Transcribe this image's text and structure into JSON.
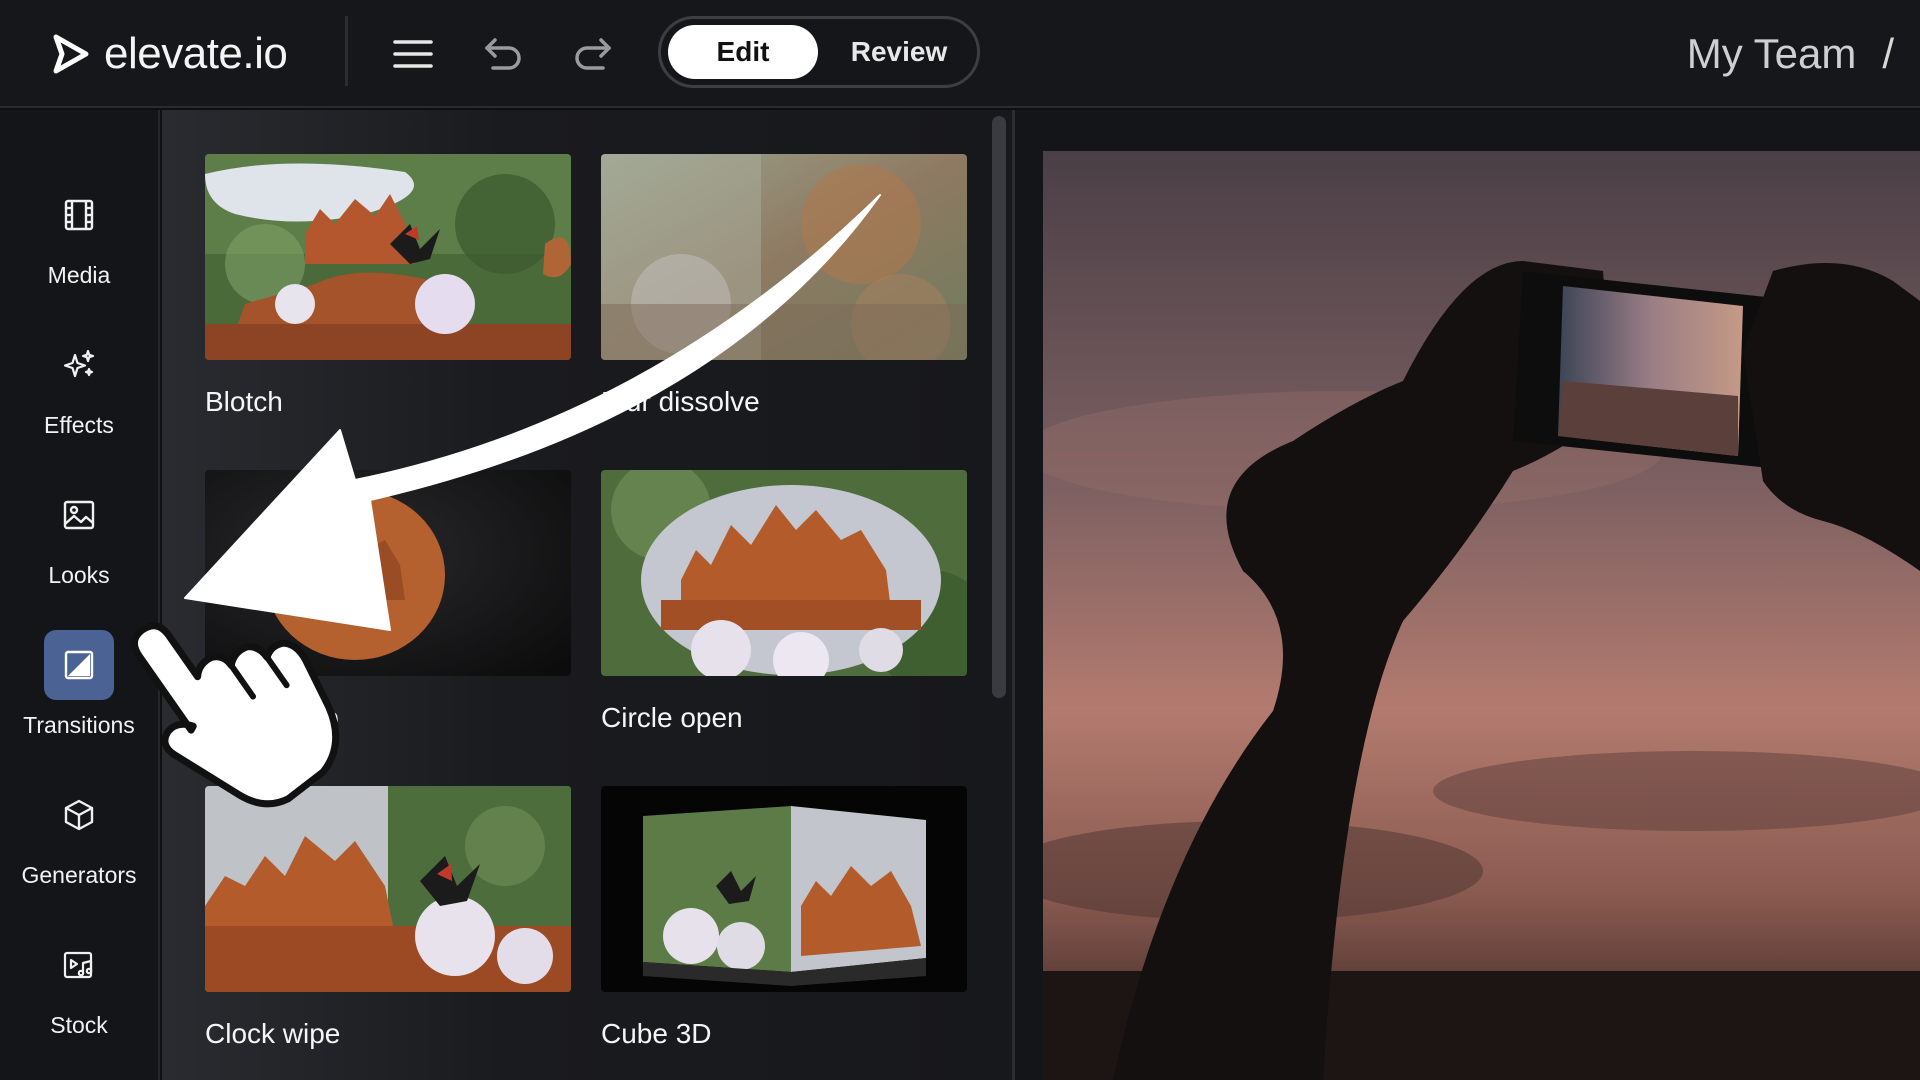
{
  "header": {
    "logo_text": "elevate.io",
    "menu_icon": "hamburger-menu-icon",
    "undo_icon": "undo-icon",
    "redo_icon": "redo-icon",
    "modes": {
      "edit": "Edit",
      "review": "Review",
      "selected": "Edit"
    },
    "team_name": "My Team",
    "breadcrumb_separator": "/"
  },
  "sidebar": {
    "items": [
      {
        "label": "Media",
        "icon": "film-icon"
      },
      {
        "label": "Effects",
        "icon": "sparkle-icon"
      },
      {
        "label": "Looks",
        "icon": "image-icon"
      },
      {
        "label": "Transitions",
        "icon": "transition-icon",
        "active": true
      },
      {
        "label": "Generators",
        "icon": "cube-icon"
      },
      {
        "label": "Stock",
        "icon": "stock-media-icon"
      }
    ]
  },
  "transitions": {
    "items": [
      {
        "label": "Blotch"
      },
      {
        "label": "Blur dissolve"
      },
      {
        "label": "Circle crop"
      },
      {
        "label": "Circle open"
      },
      {
        "label": "Clock wipe"
      },
      {
        "label": "Cube 3D"
      }
    ]
  },
  "overlay": {
    "arrow": "curved-arrow-annotation",
    "cursor": "pointing-hand-cursor"
  },
  "colors": {
    "accent_active": "#4a6294",
    "background": "#0e0f11",
    "topbar": "#16171a"
  }
}
